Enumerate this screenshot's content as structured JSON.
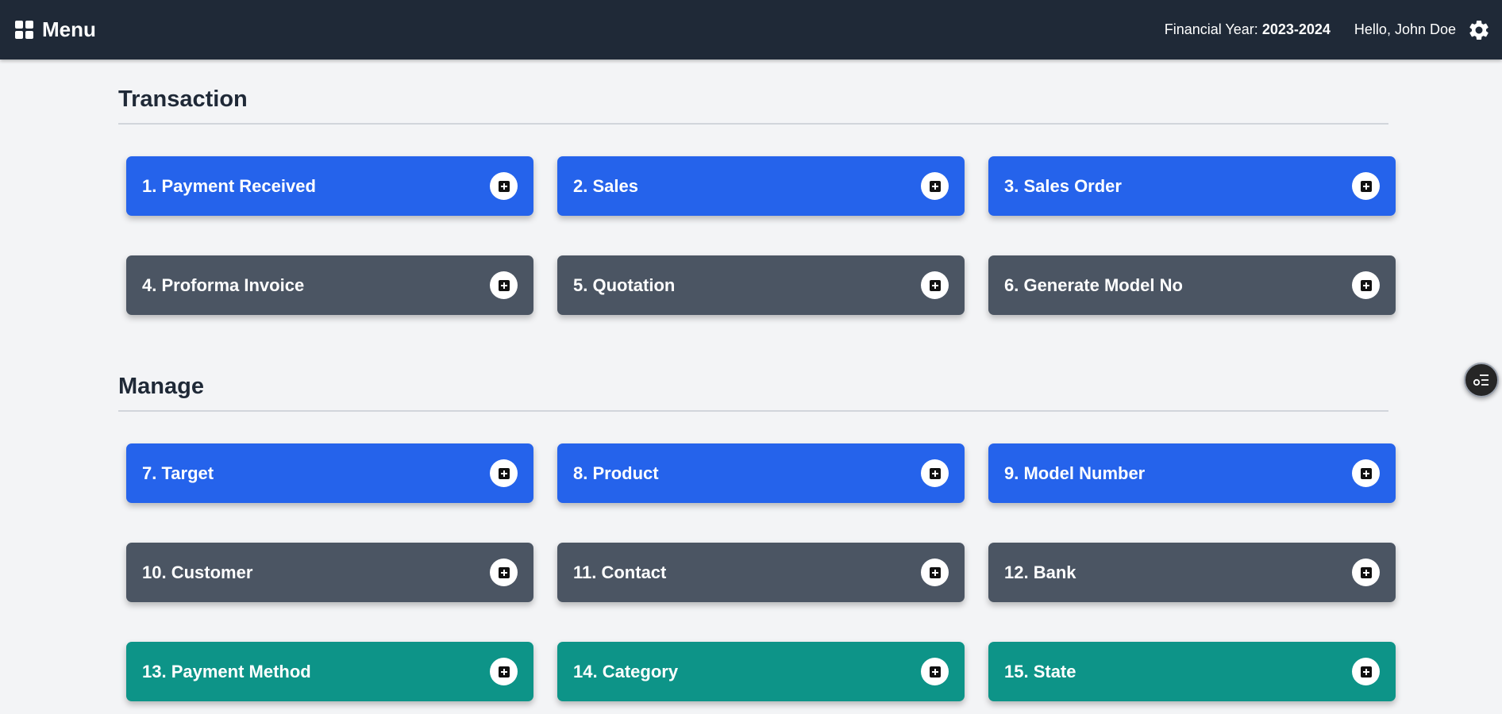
{
  "navbar": {
    "menu_label": "Menu",
    "financial_year_label": "Financial Year:",
    "financial_year_value": "2023-2024",
    "greeting": "Hello, John Doe"
  },
  "sections": [
    {
      "title": "Transaction",
      "cards": [
        {
          "label": "1. Payment Received",
          "color": "#2563eb"
        },
        {
          "label": "2. Sales",
          "color": "#2563eb"
        },
        {
          "label": "3. Sales Order",
          "color": "#2563eb"
        },
        {
          "label": "4. Proforma Invoice",
          "color": "#4b5563"
        },
        {
          "label": "5. Quotation",
          "color": "#4b5563"
        },
        {
          "label": "6. Generate Model No",
          "color": "#4b5563"
        }
      ]
    },
    {
      "title": "Manage",
      "cards": [
        {
          "label": "7. Target",
          "color": "#2563eb"
        },
        {
          "label": "8. Product",
          "color": "#2563eb"
        },
        {
          "label": "9. Model Number",
          "color": "#2563eb"
        },
        {
          "label": "10. Customer",
          "color": "#4b5563"
        },
        {
          "label": "11. Contact",
          "color": "#4b5563"
        },
        {
          "label": "12. Bank",
          "color": "#4b5563"
        },
        {
          "label": "13. Payment Method",
          "color": "#0d9488"
        },
        {
          "label": "14. Category",
          "color": "#0d9488"
        },
        {
          "label": "15. State",
          "color": "#0d9488"
        }
      ]
    }
  ],
  "icons": {
    "menu": "grid-icon",
    "settings": "gear-icon",
    "card_action": "plus-square-icon",
    "floating": "list-settings-icon"
  }
}
